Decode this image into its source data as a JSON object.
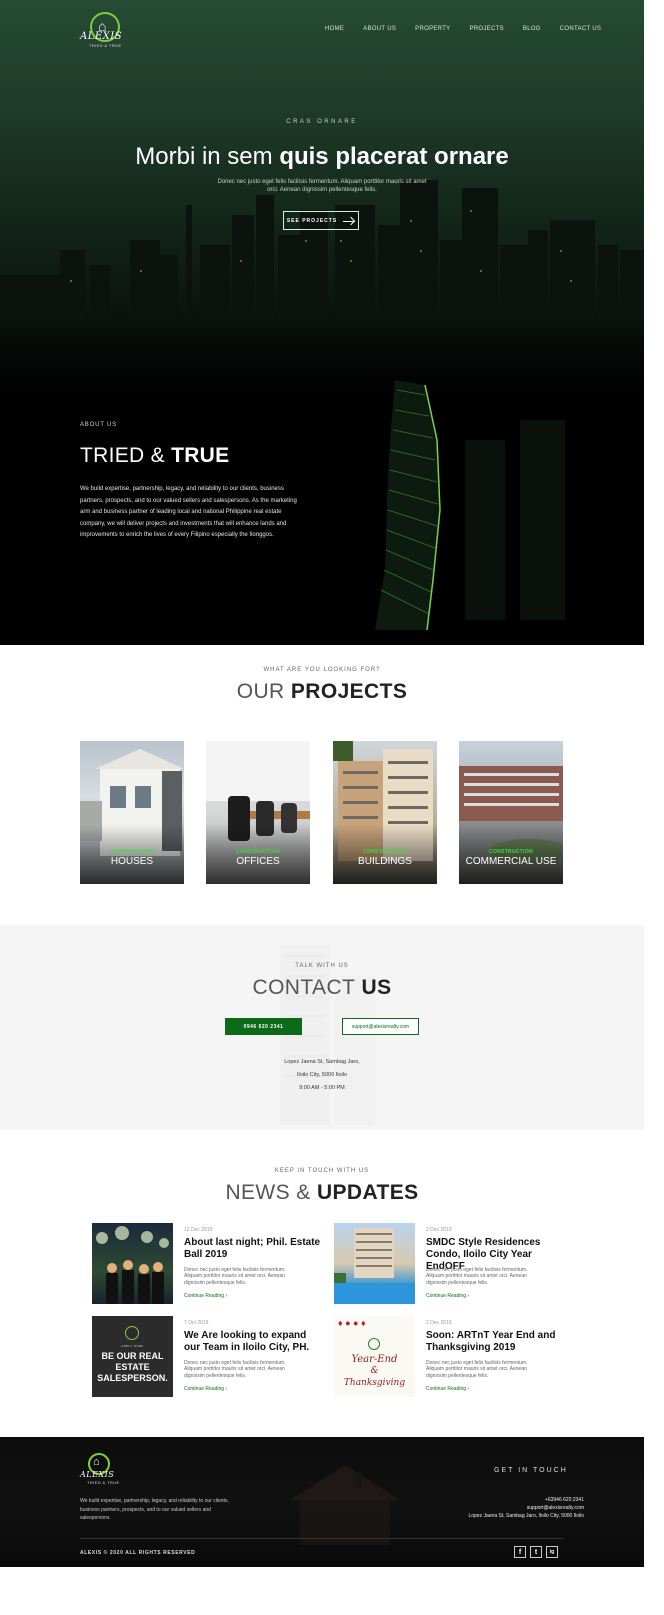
{
  "brand": {
    "name": "ALEXIS",
    "tagline": "TRIED & TRUE"
  },
  "nav": {
    "items": [
      "HOME",
      "ABOUT US",
      "PROPERTY",
      "PROJECTS",
      "BLOG",
      "CONTACT US"
    ]
  },
  "hero": {
    "eyebrow": "CRAS ORNARE",
    "title_light": "Morbi in sem",
    "title_bold": "quis placerat ornare",
    "subtitle": "Donec nec justo eget felis facilisis fermentum. Aliquam porttitor mauris sit amet orci. Aenean dignissim pellentesque felis.",
    "button": "SEE PROJECTS"
  },
  "about": {
    "eyebrow": "ABOUT US",
    "title_light": "TRIED &",
    "title_bold": "TRUE",
    "body": "We build expertise, partnership, legacy, and reliability to our clients, business partners, prospects, and to our valued sellers and salespersons. As the marketing arm and business partner of leading local and national Philippine real estate company, we will deliver projects and investments that will enhance lands and improvements to enrich the lives of every Filipino especially the Ilonggos."
  },
  "projects": {
    "eyebrow": "WHAT ARE YOU LOOKING FOR?",
    "title_light": "OUR",
    "title_bold": "PROJECTS",
    "items": [
      {
        "tag": "CONSTRUCTION",
        "name": "HOUSES"
      },
      {
        "tag": "CONSTRUCTION",
        "name": "OFFICES"
      },
      {
        "tag": "CONSTRUCTION",
        "name": "BUILDINGS"
      },
      {
        "tag": "CONSTRUCTION",
        "name": "COMMERCIAL USE"
      }
    ]
  },
  "contact": {
    "eyebrow": "TALK WITH US",
    "title_light": "CONTACT",
    "title_bold": "US",
    "phone": "0946 620 2341",
    "email": "support@alexisrealty.com",
    "address_line1": "Lopez Jaena St, Sambag Jaro,",
    "address_line2": "Iloilo City, 5000 Iloilo",
    "hours": "9:00 AM - 5:00 PM"
  },
  "news": {
    "eyebrow": "KEEP IN TOUCH WITH US",
    "title_light": "NEWS &",
    "title_bold": "UPDATES",
    "link_label": "Continue Reading",
    "excerpt": "Donec nec justo eget felis facilisis fermentum. Aliquam porttitor mauris sit amet orci. Aenean dignissim pellentesque felis.",
    "items": [
      {
        "date": "12 Dec 2019",
        "title": "About last night; Phil. Estate Ball 2019"
      },
      {
        "date": "2 Dec 2019",
        "title": "SMDC Style Residences Condo, Iloilo City Year EndOFF"
      },
      {
        "date": "7 Oct 2019",
        "title": "We Are looking to expand our Team in Iloilo City, PH."
      },
      {
        "date": "2 Dec 2019",
        "title": "Soon: ARTnT Year End and Thanksgiving 2019"
      }
    ],
    "image_text": {
      "hiring_small": "APPLY NOW!",
      "hiring_big": "BE OUR REAL ESTATE SALESPERSON.",
      "year_end": "Year-End",
      "amp": "&",
      "thanks": "Thanksgiving"
    }
  },
  "footer": {
    "body": "We build expertise, partnership, legacy, and reliability to our clients, business partners, prospects, and to our valued sellers and salespersons.",
    "get_in_touch": "GET IN TOUCH",
    "phone": "+63946 620 2341",
    "email": "support@alexisrealty.com",
    "address": "Lopez Jaena St, Sambag Jaro, Iloilo City, 5000 Iloilo",
    "copyright": "ALEXIS © 2020 ALL RIGHTS RESERVED",
    "social": [
      "f",
      "t",
      "ig"
    ]
  },
  "colors": {
    "accent": "#0c6b18",
    "hero_green": "#264b34",
    "tag_green": "#3ddc3a"
  }
}
